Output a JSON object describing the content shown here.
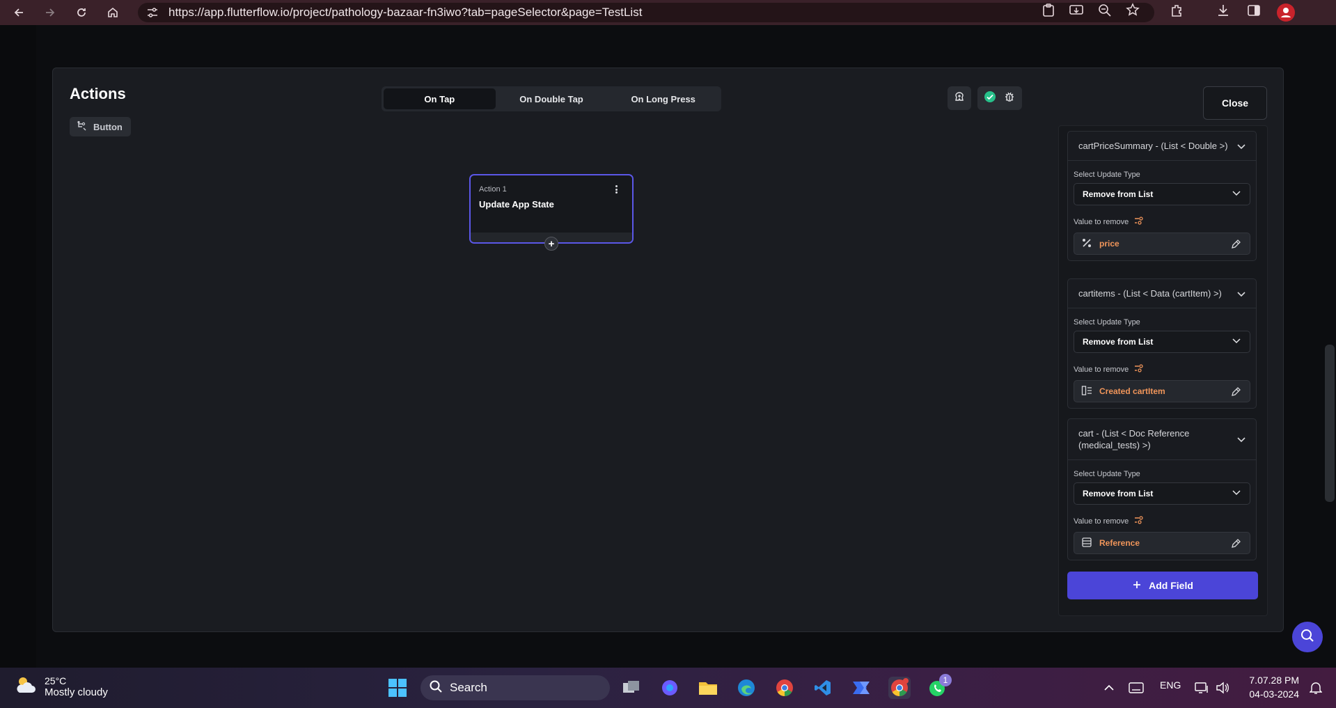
{
  "browser": {
    "url": "https://app.flutterflow.io/project/pathology-bazaar-fn3iwo?tab=pageSelector&page=TestList",
    "profile_badge": ""
  },
  "modal": {
    "title": "Actions",
    "widget_chip": "Button",
    "tabs": [
      {
        "label": "On Tap",
        "active": true
      },
      {
        "label": "On Double Tap",
        "active": false
      },
      {
        "label": "On Long Press",
        "active": false
      }
    ],
    "close_label": "Close"
  },
  "action_node": {
    "label": "Action 1",
    "title": "Update App State"
  },
  "panel": {
    "fields": [
      {
        "header": "cartPriceSummary - (List < Double >)",
        "select_label": "Select Update Type",
        "select_value": "Remove from List",
        "value_label": "Value to remove",
        "value": "price",
        "value_icon": "percent-icon"
      },
      {
        "header": "cartitems - (List < Data (cartItem) >)",
        "select_label": "Select Update Type",
        "select_value": "Remove from List",
        "value_label": "Value to remove",
        "value": "Created cartItem",
        "value_icon": "data-struct-icon"
      },
      {
        "header": "cart - (List < Doc Reference (medical_tests) >)",
        "select_label": "Select Update Type",
        "select_value": "Remove from List",
        "value_label": "Value to remove",
        "value": "Reference",
        "value_icon": "database-icon"
      }
    ],
    "add_field_label": "Add Field"
  },
  "taskbar": {
    "weather_temp": "25°C",
    "weather_cond": "Mostly cloudy",
    "search_label": "Search",
    "lang": "ENG",
    "time": "7.07.28 PM",
    "date": "04-03-2024",
    "whatsapp_badge": "1"
  },
  "colors": {
    "accent": "#4b45d8",
    "node_border": "#5b57e8",
    "value_text": "#f0955a",
    "browser_bar": "#3a2129"
  }
}
